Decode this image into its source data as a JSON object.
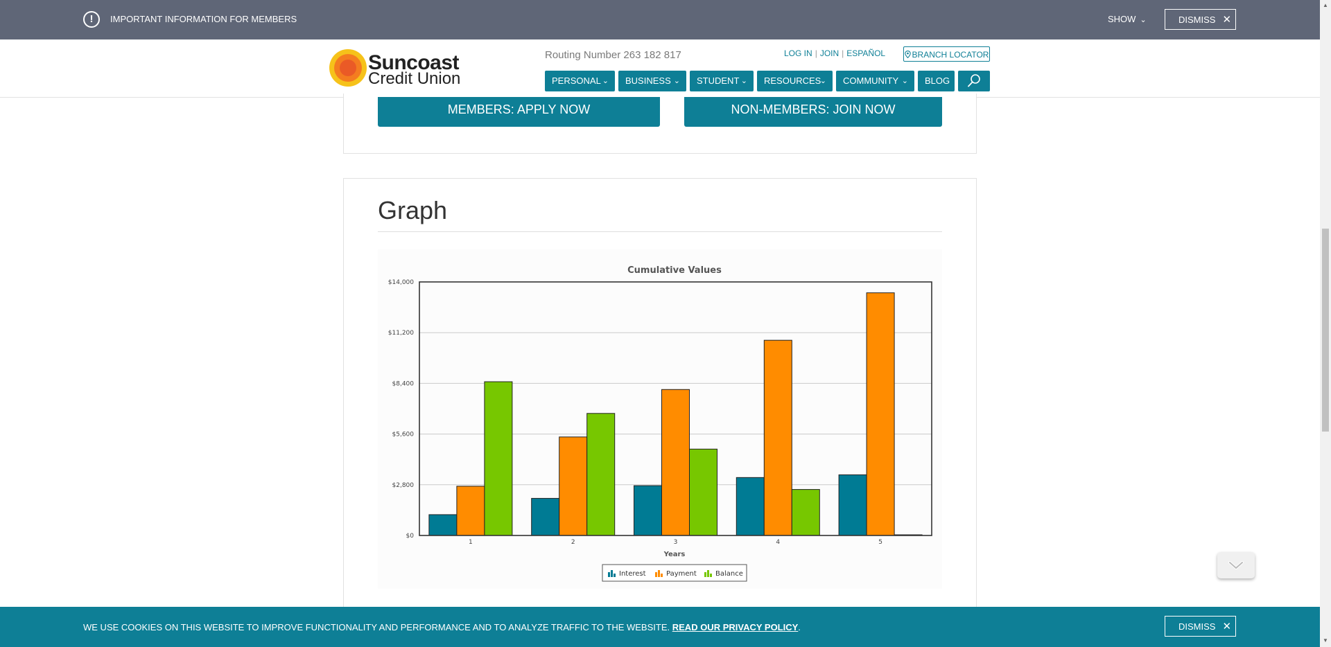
{
  "alert": {
    "text": "IMPORTANT INFORMATION FOR MEMBERS",
    "show_label": "SHOW",
    "dismiss_label": "DISMISS"
  },
  "header": {
    "logo_line1": "Suncoast",
    "logo_line2": "Credit Union",
    "routing": "Routing Number 263 182 817",
    "log_in": "LOG IN",
    "join": "JOIN",
    "espanol": "ESPAÑOL",
    "branch_locator": "BRANCH LOCATOR"
  },
  "nav": {
    "personal": "PERSONAL",
    "business": "BUSINESS",
    "student": "STUDENT",
    "resources": "RESOURCES",
    "community": "COMMUNITY",
    "blog": "BLOG"
  },
  "apply": {
    "members": "MEMBERS: APPLY NOW",
    "non_members": "NON-MEMBERS: JOIN NOW"
  },
  "graph_section": {
    "title": "Graph"
  },
  "chart_data": {
    "type": "bar",
    "title": "Cumulative Values",
    "xlabel": "Years",
    "ylabel": "",
    "categories": [
      "1",
      "2",
      "3",
      "4",
      "5"
    ],
    "series": [
      {
        "name": "Interest",
        "values": [
          1150,
          2050,
          2750,
          3200,
          3350
        ],
        "color": "#007b94"
      },
      {
        "name": "Payment",
        "values": [
          2720,
          5440,
          8060,
          10780,
          13400
        ],
        "color": "#ff8c00"
      },
      {
        "name": "Balance",
        "values": [
          8490,
          6740,
          4770,
          2540,
          0
        ],
        "color": "#77c700"
      }
    ],
    "ylim": [
      0,
      14000
    ],
    "yticks": [
      "$0",
      "$2,800",
      "$5,600",
      "$8,400",
      "$11,200",
      "$14,000"
    ],
    "grid": true,
    "legend": "bottom"
  },
  "cookie": {
    "text": "WE USE COOKIES ON THIS WEBSITE TO IMPROVE FUNCTIONALITY AND PERFORMANCE AND TO ANALYZE TRAFFIC TO THE WEBSITE.",
    "link": "READ OUR PRIVACY POLICY",
    "period": ".",
    "dismiss_label": "DISMISS"
  }
}
